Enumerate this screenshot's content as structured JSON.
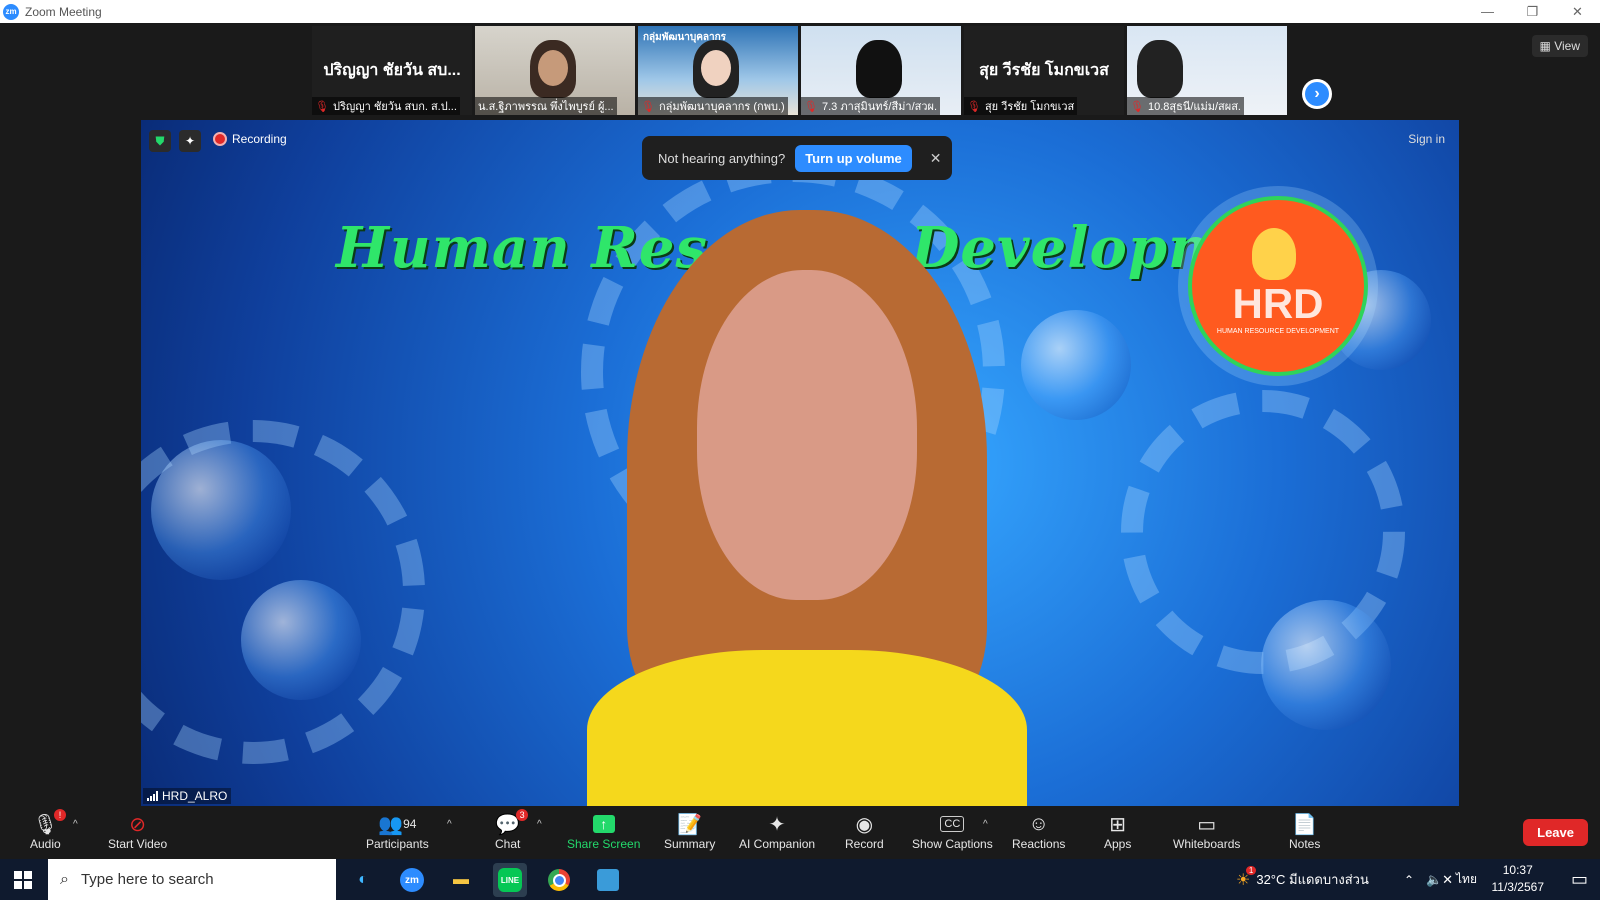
{
  "window": {
    "app_icon": "zm",
    "title": "Zoom Meeting",
    "controls": [
      "—",
      "❐",
      "✕"
    ]
  },
  "gallery": {
    "tiles": [
      {
        "big_name": "ปริญญา ชัยวัน สบ...",
        "label": "ปริญญา ชัยวัน สบก. ส.ป...",
        "type": "name"
      },
      {
        "big_name": "",
        "label": "น.ส.ฐิภาพรรณ พึ่งไพบูรย์ ผู้...",
        "type": "cam1"
      },
      {
        "big_name": "",
        "label": "กลุ่มพัฒนาบุคลากร (กพบ.)",
        "type": "cam2",
        "overlay": "กลุ่มพัฒนาบุคลากร"
      },
      {
        "big_name": "",
        "label": "7.3 ภาสุมินทร์/สีม่า/สวผ.",
        "type": "cam3"
      },
      {
        "big_name": "สุย วีรชัย โมกขเวส",
        "label": "สุย วีรชัย โมกขเวส",
        "type": "name"
      },
      {
        "big_name": "",
        "label": "10.8สุธนี/แม่ม/สผส.",
        "type": "cam4"
      }
    ],
    "view_label": "View"
  },
  "main_video": {
    "recording_label": "Recording",
    "sign_in": "Sign in",
    "toast": {
      "message": "Not hearing anything?",
      "button": "Turn up volume",
      "close": "✕"
    },
    "participant_name": "HRD_ALRO",
    "background_title": "Human Resource Development",
    "logo_text": "HRD",
    "logo_subtext": "HUMAN RESOURCE DEVELOPMENT"
  },
  "toolbar": {
    "audio": {
      "label": "Audio",
      "badge": "!"
    },
    "video": {
      "label": "Start Video"
    },
    "participants": {
      "label": "Participants",
      "count": "94"
    },
    "chat": {
      "label": "Chat",
      "badge": "3"
    },
    "share": {
      "label": "Share Screen"
    },
    "summary": {
      "label": "Summary"
    },
    "ai": {
      "label": "AI Companion"
    },
    "record": {
      "label": "Record"
    },
    "captions": {
      "label": "Show Captions"
    },
    "reactions": {
      "label": "Reactions"
    },
    "apps": {
      "label": "Apps"
    },
    "whiteboards": {
      "label": "Whiteboards"
    },
    "notes": {
      "label": "Notes"
    },
    "leave": {
      "label": "Leave"
    }
  },
  "taskbar": {
    "search_placeholder": "Type here to search",
    "weather": "32°C มีแดดบางส่วน",
    "weather_badge": "1",
    "lang": "ไทย",
    "time": "10:37",
    "date": "11/3/2567"
  },
  "colors": {
    "accent": "#2d8cff",
    "leave": "#e02828",
    "share": "#23d96b",
    "taskbar": "#0f1a2e"
  }
}
